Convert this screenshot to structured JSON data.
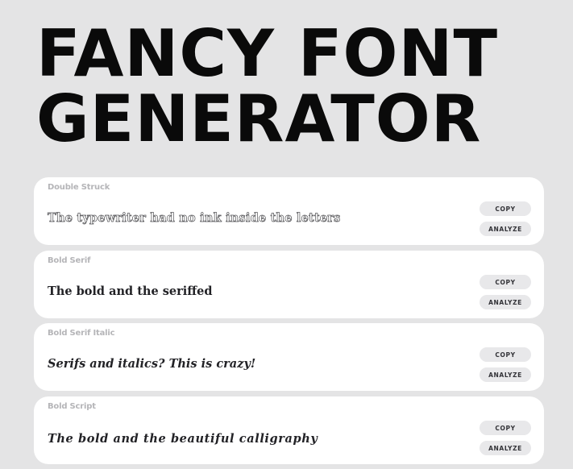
{
  "header": {
    "title_line1": "FANCY FONT",
    "title_line2": "GENERATOR"
  },
  "cards": [
    {
      "label": "Double Struck",
      "sample": "The typewriter had no ink inside the letters",
      "copy_label": "COPY",
      "analyze_label": "ANALYZE"
    },
    {
      "label": "Bold Serif",
      "sample": "The bold and the seriffed",
      "copy_label": "COPY",
      "analyze_label": "ANALYZE"
    },
    {
      "label": "Bold Serif Italic",
      "sample": "Serifs and italics? This is crazy!",
      "copy_label": "COPY",
      "analyze_label": "ANALYZE"
    },
    {
      "label": "Bold Script",
      "sample": "The bold and the beautiful calligraphy",
      "copy_label": "COPY",
      "analyze_label": "ANALYZE"
    }
  ],
  "colors": {
    "background": "#e4e4e5",
    "card": "#ffffff",
    "button": "#e8e8ea",
    "label": "#b5b5b8",
    "title": "#0a0a0a"
  }
}
